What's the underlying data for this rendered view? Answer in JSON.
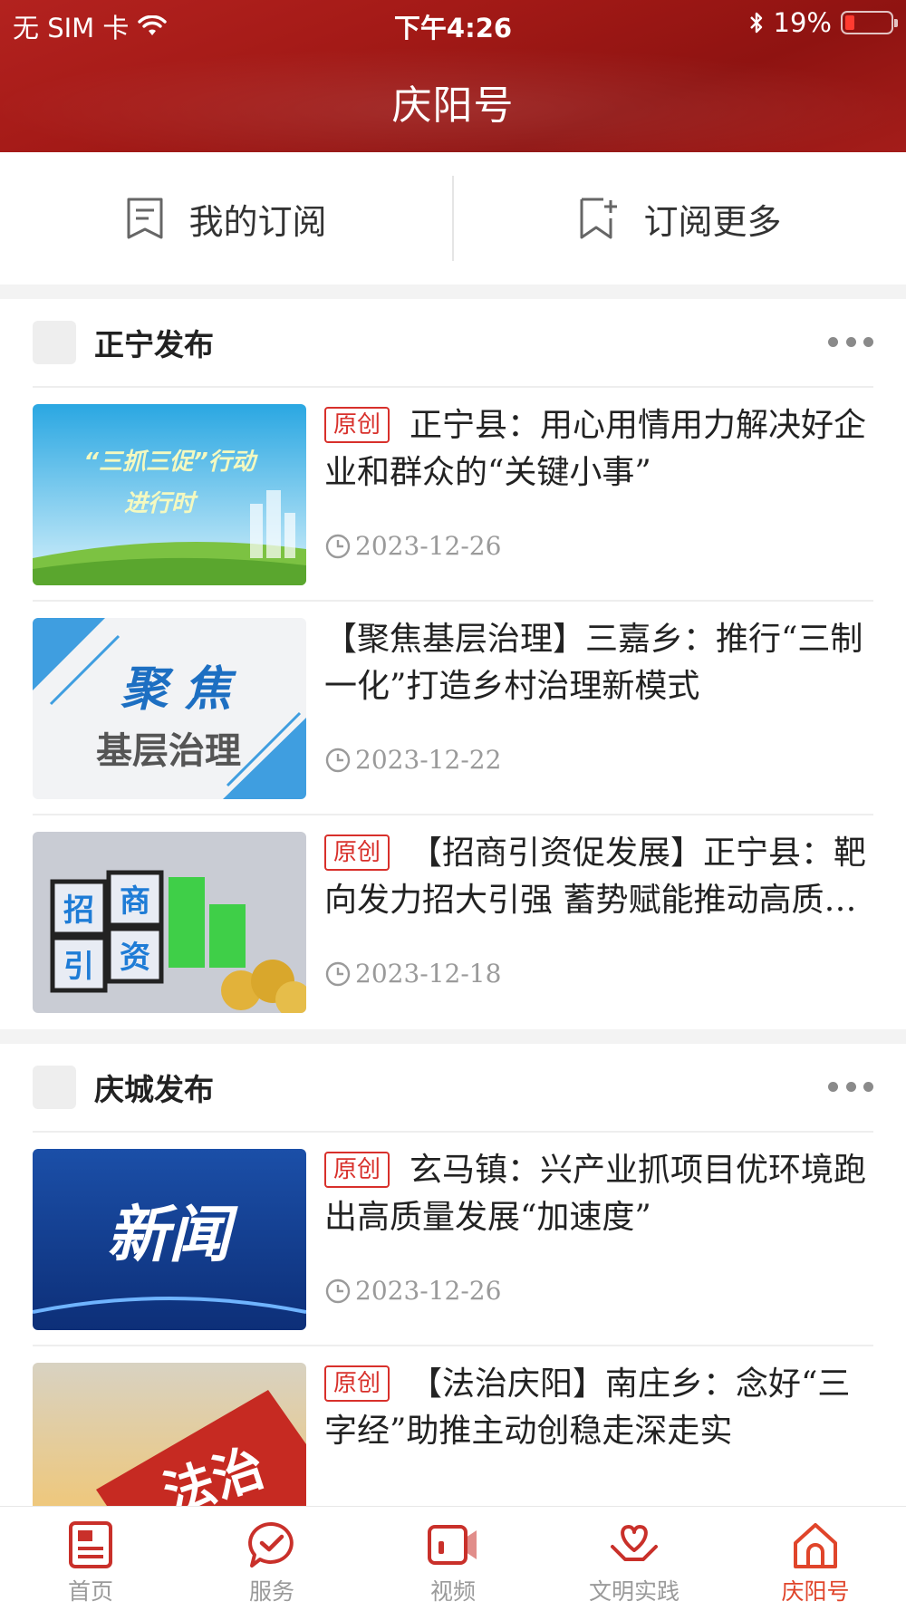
{
  "status_bar": {
    "carrier": "无 SIM 卡",
    "time": "下午4:26",
    "battery": "19%",
    "battery_level": 0.19
  },
  "header": {
    "title": "庆阳号"
  },
  "subscribe_bar": {
    "my_subscriptions": "我的订阅",
    "subscribe_more": "订阅更多"
  },
  "sections": [
    {
      "name": "正宁发布",
      "articles": [
        {
          "badge": "原创",
          "title": "正宁县：用心用情用力解决好企业和群众的“关键小事”",
          "date": "2023-12-26",
          "thumb_text": [
            "“三抓三促”行动",
            "进行时"
          ]
        },
        {
          "badge": "",
          "title": "【聚焦基层治理】三嘉乡：推行“三制一化”打造乡村治理新模式",
          "date": "2023-12-22",
          "thumb_text": [
            "聚  焦",
            "基层治理"
          ]
        },
        {
          "badge": "原创",
          "title": "【招商引资促发展】正宁县：靶向发力招大引强 蓄势赋能推动高质量发展",
          "date": "2023-12-18",
          "thumb_text": [
            "招",
            "商",
            "引",
            "资"
          ]
        }
      ]
    },
    {
      "name": "庆城发布",
      "articles": [
        {
          "badge": "原创",
          "title": "玄马镇：兴产业抓项目优环境跑出高质量发展“加速度”",
          "date": "2023-12-26",
          "thumb_text": [
            "新闻"
          ]
        },
        {
          "badge": "原创",
          "title": "【法治庆阳】南庄乡：念好“三字经”助推主动创稳走深走实",
          "date": "",
          "thumb_text": [
            "法治"
          ]
        }
      ]
    }
  ],
  "tabbar": {
    "items": [
      {
        "label": "首页",
        "icon": "newspaper-icon"
      },
      {
        "label": "服务",
        "icon": "chat-check-icon"
      },
      {
        "label": "视频",
        "icon": "video-camera-icon"
      },
      {
        "label": "文明实践",
        "icon": "heart-hands-icon"
      },
      {
        "label": "庆阳号",
        "icon": "home-icon",
        "active": true
      }
    ]
  },
  "colors": {
    "brand_red": "#a41a17",
    "accent": "#e0452b",
    "badge_red": "#d8302b"
  }
}
